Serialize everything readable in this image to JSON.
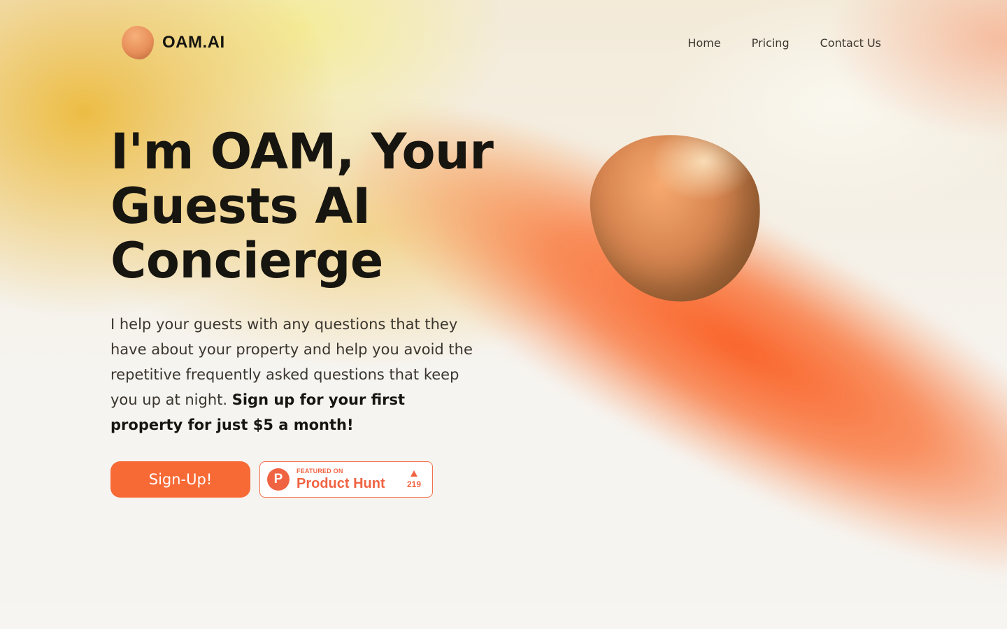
{
  "brand": {
    "name": "OAM.AI",
    "logo_icon": "orange-blob-logo-icon"
  },
  "nav": {
    "items": [
      {
        "label": "Home"
      },
      {
        "label": "Pricing"
      },
      {
        "label": "Contact Us"
      }
    ]
  },
  "hero": {
    "title_lines": [
      "I'm OAM, Your",
      "Guests AI",
      "Concierge"
    ],
    "description": "I help your guests with any questions that they have about your property and help you avoid the repetitive frequently asked questions that keep you up at night.",
    "description_bold": "Sign up for your first property for just $5 a month!",
    "signup_label": "Sign-Up!"
  },
  "product_hunt": {
    "featured_label": "FEATURED ON",
    "name": "Product Hunt",
    "logo_letter": "P",
    "votes": "219"
  },
  "colors": {
    "accent": "#f76a36",
    "product_hunt": "#f06342",
    "text": "#17150f"
  }
}
